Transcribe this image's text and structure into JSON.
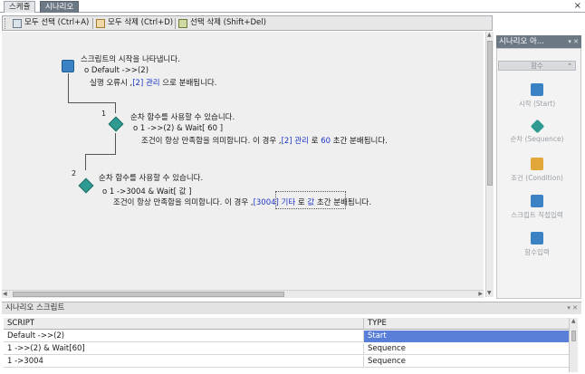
{
  "top_tabs": [
    {
      "label": "스케쥴"
    },
    {
      "label": "시나리오"
    }
  ],
  "close_glyph": "×",
  "toolbar": {
    "select_all": "모두 선택 (Ctrl+A)",
    "delete_all": "모두 삭제 (Ctrl+D)",
    "delete_selected": "선택 삭제 (Shift+Del)"
  },
  "canvas": {
    "start": {
      "title": "스크립트의 시작을 나타냅니다.",
      "rule": "Default ->>(2)",
      "desc_pre": "실행 오류시 ,",
      "desc_link": "[2] 관리",
      "desc_post": " 으로 분배됩니다."
    },
    "seq1": {
      "num": "1",
      "title": "순차 함수를 사용할 수 있습니다.",
      "rule": "1 ->>(2) & Wait[ 60 ]",
      "desc_pre": "조건이 항상 만족함을 의미합니다. 이 경우 ,",
      "desc_link": "[2] 관리",
      "desc_mid": " 로 ",
      "desc_num": "60",
      "desc_post": " 초간 분배됩니다."
    },
    "seq2": {
      "num": "2",
      "title": "순차 함수를 사용할 수 있습니다.",
      "rule": "1 ->3004 & Wait[ 값 ]",
      "desc_pre": "조건이 항상 만족함을 의미합니다. 이 경우 ,",
      "desc_link": "[3004] 기타",
      "desc_mid": " 로 ",
      "desc_num": "값",
      "desc_post": " 초간 분배됩니다."
    }
  },
  "right_panel": {
    "title": "시나리오 아...",
    "pins": "▾ ✕",
    "section": "함수",
    "section_chevron": "⌃",
    "items": [
      {
        "label": "시작 (Start)",
        "color": "#3a82c4"
      },
      {
        "label": "순차 (Sequence)",
        "color": "#2f9a92"
      },
      {
        "label": "조건 (Condition)",
        "color": "#e1a73b"
      },
      {
        "label": "스크립트 직접입력",
        "color": "#3a82c4"
      },
      {
        "label": "함수입력",
        "color": "#3a82c4"
      }
    ]
  },
  "bottom_panel": {
    "title": "시나리오 스크립트",
    "pins": "▾ ✕",
    "columns": [
      "SCRIPT",
      "TYPE"
    ],
    "rows": [
      {
        "script": "Default ->>(2)",
        "type": "Start"
      },
      {
        "script": "1 ->>(2) & Wait[60]",
        "type": "Sequence"
      },
      {
        "script": "1 ->3004",
        "type": "Sequence"
      }
    ]
  }
}
